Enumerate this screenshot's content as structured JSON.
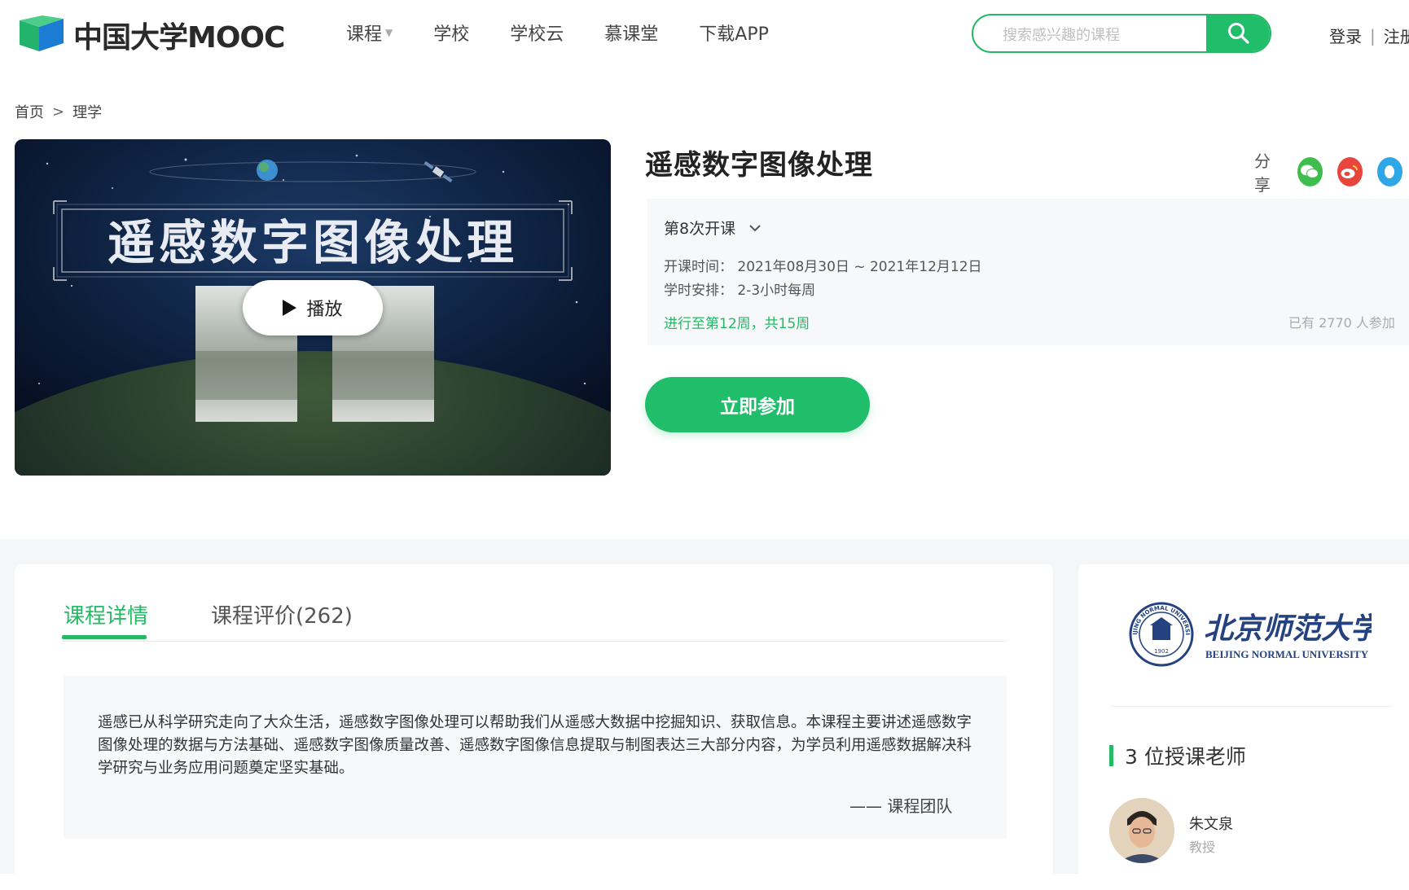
{
  "header": {
    "logo_text": "中国大学MOOC",
    "nav": [
      {
        "label": "课程",
        "has_dropdown": true
      },
      {
        "label": "学校"
      },
      {
        "label": "学校云"
      },
      {
        "label": "慕课堂"
      },
      {
        "label": "下载APP"
      }
    ],
    "search_placeholder": "搜索感兴趣的课程",
    "login": "登录",
    "register": "注册"
  },
  "breadcrumb": {
    "home": "首页",
    "separator": ">",
    "current": "理学"
  },
  "video": {
    "banner_title": "遥感数字图像处理",
    "play_label": "播放"
  },
  "course": {
    "title": "遥感数字图像处理",
    "share_label": "分享",
    "share_icons": [
      "wechat-icon",
      "weibo-icon",
      "qq-icon"
    ],
    "term": "第8次开课",
    "time_label": "开课时间：",
    "time_value": "2021年08月30日 ~ 2021年12月12日",
    "hours_label": "学时安排：",
    "hours_value": "2-3小时每周",
    "progress": "进行至第12周，共15周",
    "joined": "已有 2770 人参加",
    "join_button": "立即参加"
  },
  "details": {
    "tabs": [
      {
        "label": "课程详情",
        "active": true
      },
      {
        "label": "课程评价(262)",
        "active": false
      }
    ],
    "description": "遥感已从科学研究走向了大众生活，遥感数字图像处理可以帮助我们从遥感大数据中挖掘知识、获取信息。本课程主要讲述遥感数字图像处理的数据与方法基础、遥感数字图像质量改善、遥感数字图像信息提取与制图表达三大部分内容，为学员利用遥感数据解决科学研究与业务应用问题奠定坚实基础。",
    "signature": "—— 课程团队"
  },
  "sidebar": {
    "university_cn": "北京师范大学",
    "university_en": "BEIJING NORMAL UNIVERSITY",
    "seal_text": "BEIJING NORMAL UNIVERSITY",
    "seal_year": "1902",
    "teachers_heading": "3 位授课老师",
    "teacher": {
      "name": "朱文泉",
      "role": "教授"
    }
  },
  "colors": {
    "brand_green": "#20be6b",
    "text_dark": "#333333",
    "muted": "#aaaaaa",
    "info_bg": "#f7f8fa"
  }
}
